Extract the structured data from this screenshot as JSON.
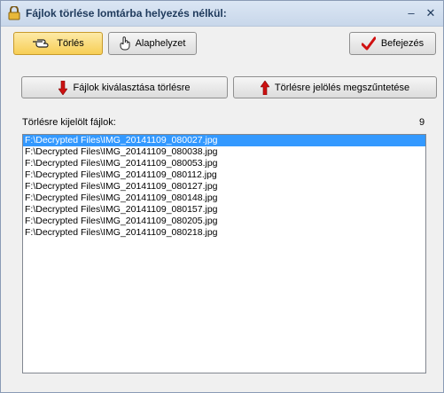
{
  "window": {
    "title": "Fájlok törlése lomtárba helyezés nélkül:",
    "minimize_glyph": "–",
    "close_glyph": "✕"
  },
  "toolbar": {
    "delete_label": "Törlés",
    "reset_label": "Alaphelyzet",
    "finish_label": "Befejezés"
  },
  "actions": {
    "select_label": "Fájlok kiválasztása törlésre",
    "unmark_label": "Törlésre jelölés megszűntetése"
  },
  "files": {
    "header": "Törlésre kijelölt fájlok:",
    "count": "9",
    "items": [
      "F:\\Decrypted Files\\IMG_20141109_080027.jpg",
      "F:\\Decrypted Files\\IMG_20141109_080038.jpg",
      "F:\\Decrypted Files\\IMG_20141109_080053.jpg",
      "F:\\Decrypted Files\\IMG_20141109_080112.jpg",
      "F:\\Decrypted Files\\IMG_20141109_080127.jpg",
      "F:\\Decrypted Files\\IMG_20141109_080148.jpg",
      "F:\\Decrypted Files\\IMG_20141109_080157.jpg",
      "F:\\Decrypted Files\\IMG_20141109_080205.jpg",
      "F:\\Decrypted Files\\IMG_20141109_080218.jpg"
    ]
  },
  "icons": {
    "title": "lock-icon",
    "delete": "pointing-hand-icon",
    "reset": "hand-up-icon",
    "finish": "checkmark-icon",
    "select": "arrow-down-icon",
    "unmark": "arrow-up-icon"
  },
  "colors": {
    "selection": "#3399ff",
    "active_button": "#f7ce55",
    "arrow_red": "#cc1111",
    "titlebar": "#c8d7ea"
  }
}
